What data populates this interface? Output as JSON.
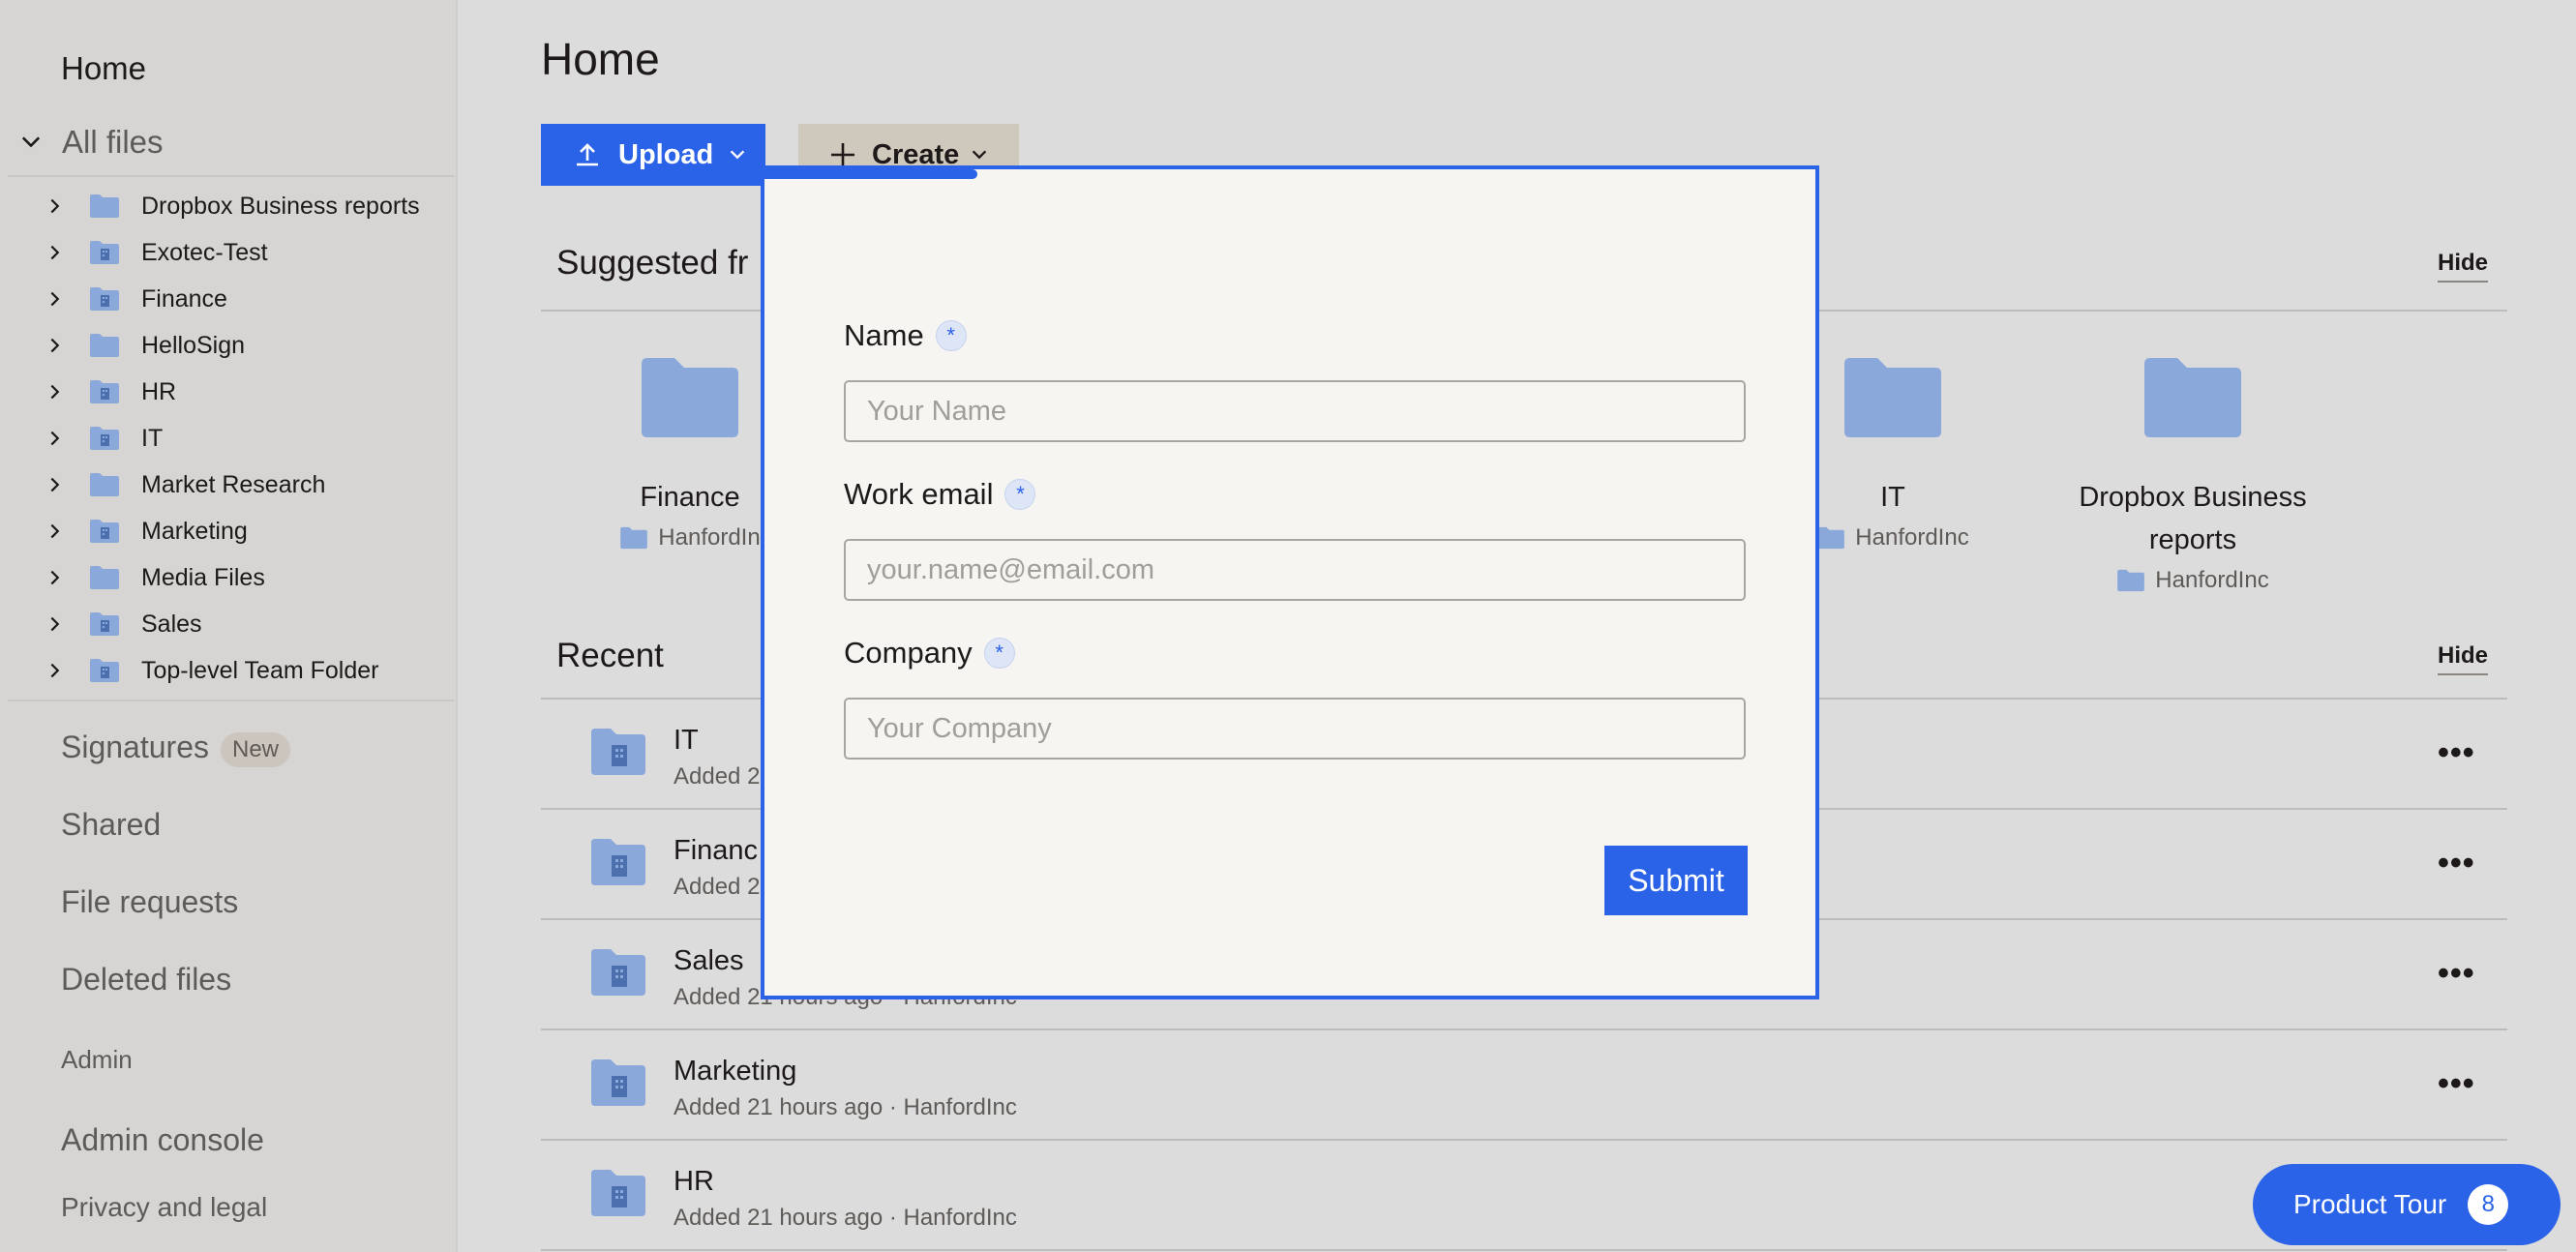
{
  "sidebar": {
    "home": "Home",
    "all_files": "All files",
    "tree": [
      {
        "label": "Dropbox Business reports",
        "icon": "folder-icon"
      },
      {
        "label": "Exotec-Test",
        "icon": "team-folder-icon"
      },
      {
        "label": "Finance",
        "icon": "team-folder-icon"
      },
      {
        "label": "HelloSign",
        "icon": "folder-icon"
      },
      {
        "label": "HR",
        "icon": "team-folder-icon"
      },
      {
        "label": "IT",
        "icon": "team-folder-icon"
      },
      {
        "label": "Market Research",
        "icon": "folder-icon"
      },
      {
        "label": "Marketing",
        "icon": "team-folder-icon"
      },
      {
        "label": "Media Files",
        "icon": "folder-icon"
      },
      {
        "label": "Sales",
        "icon": "team-folder-icon"
      },
      {
        "label": "Top-level Team Folder",
        "icon": "team-folder-icon"
      }
    ],
    "signatures": "Signatures",
    "signatures_badge": "New",
    "shared": "Shared",
    "file_requests": "File requests",
    "deleted_files": "Deleted files",
    "admin": "Admin",
    "admin_console": "Admin console",
    "privacy": "Privacy and legal"
  },
  "main": {
    "title": "Home",
    "upload_label": "Upload",
    "create_label": "Create",
    "suggested_title": "Suggested fr",
    "hide_label": "Hide",
    "suggested": [
      {
        "name": "Finance",
        "owner": "HanfordIn"
      },
      {
        "name": "IT",
        "owner": "HanfordInc"
      },
      {
        "name": "Dropbox Business reports",
        "owner": "HanfordInc"
      }
    ],
    "recent_title": "Recent",
    "recent": [
      {
        "name": "IT",
        "meta": "Added 2"
      },
      {
        "name": "Financ",
        "meta": "Added 2"
      },
      {
        "name": "Sales",
        "meta": "Added 21 hours ago · HanfordInc"
      },
      {
        "name": "Marketing",
        "meta": "Added 21 hours ago · HanfordInc"
      },
      {
        "name": "HR",
        "meta": "Added 21 hours ago · HanfordInc"
      }
    ],
    "more_label": "•••"
  },
  "modal": {
    "fields": [
      {
        "label": "Name",
        "placeholder": "Your Name",
        "required_mark": "*"
      },
      {
        "label": "Work email",
        "placeholder": "your.name@email.com",
        "required_mark": "*"
      },
      {
        "label": "Company",
        "placeholder": "Your Company",
        "required_mark": "*"
      }
    ],
    "submit_label": "Submit"
  },
  "tour": {
    "label": "Product Tour",
    "count": "8"
  },
  "colors": {
    "accent": "#2a62e8",
    "folder": "#8aa8d9",
    "sidebar_bg": "#d6d5d3",
    "modal_bg": "#f6f5f2"
  }
}
